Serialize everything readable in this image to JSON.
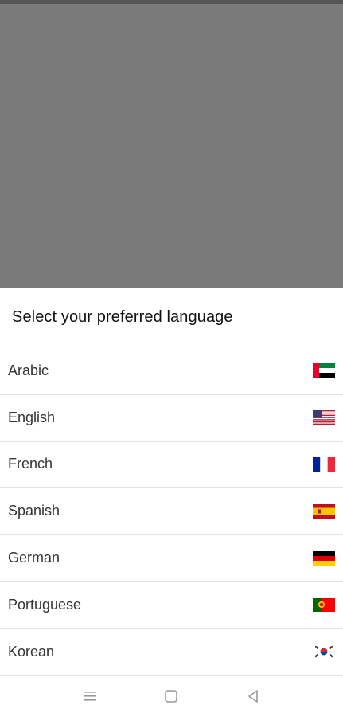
{
  "sheet": {
    "title": "Select your preferred language"
  },
  "languages": [
    {
      "label": "Arabic",
      "flag": "uae-flag-icon"
    },
    {
      "label": "English",
      "flag": "usa-flag-icon"
    },
    {
      "label": "French",
      "flag": "france-flag-icon"
    },
    {
      "label": "Spanish",
      "flag": "spain-flag-icon"
    },
    {
      "label": "German",
      "flag": "germany-flag-icon"
    },
    {
      "label": "Portuguese",
      "flag": "portugal-flag-icon"
    },
    {
      "label": "Korean",
      "flag": "korea-flag-icon"
    }
  ],
  "nav": {
    "buttons": [
      "menu-icon",
      "home-icon",
      "back-icon"
    ]
  },
  "colors": {
    "overlay": "#7a7a7a",
    "divider": "#e2e2e2"
  }
}
